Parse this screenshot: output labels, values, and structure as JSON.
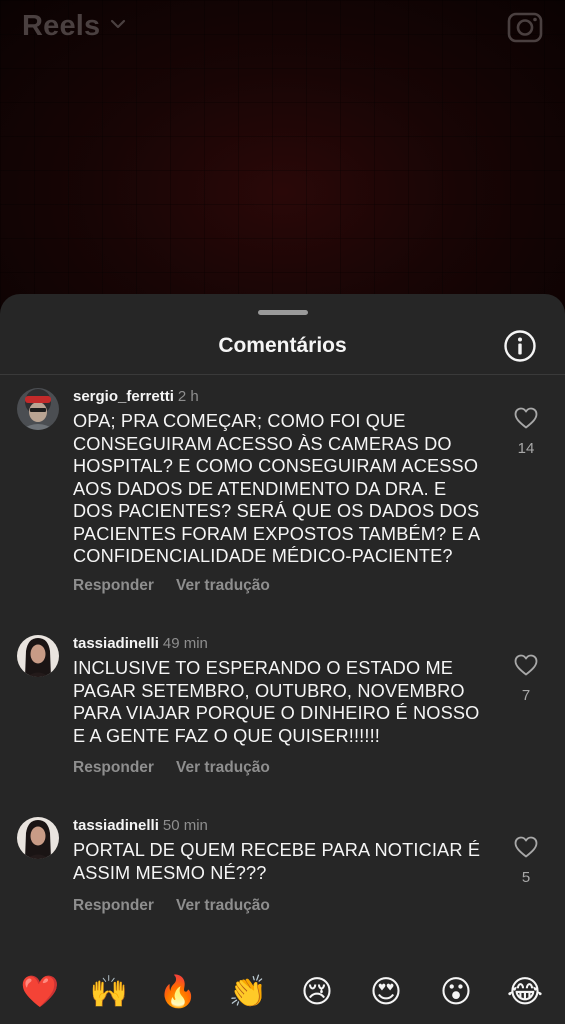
{
  "header": {
    "title": "Reels"
  },
  "sheet": {
    "title": "Comentários"
  },
  "comments": [
    {
      "username": "sergio_ferretti",
      "time": "2 h",
      "text": "OPA; PRA COMEÇAR; COMO FOI QUE\nCONSEGUIRAM ACESSO ÀS CAMERAS DO\nHOSPITAL? E COMO CONSEGUIRAM ACESSO\nAOS DADOS DE ATENDIMENTO DA DRA. E\nDOS PACIENTES? SERÁ QUE OS DADOS DOS\nPACIENTES FORAM EXPOSTOS TAMBÉM? E A\nCONFIDENCIALIDADE MÉDICO-PACIENTE?",
      "reply": "Responder",
      "translate": "Ver tradução",
      "likes": "14"
    },
    {
      "username": "tassiadinelli",
      "time": "49 min",
      "text": "INCLUSIVE TO ESPERANDO O ESTADO ME\nPAGAR SETEMBRO, OUTUBRO, NOVEMBRO\nPARA VIAJAR PORQUE O DINHEIRO É NOSSO\nE A GENTE FAZ O QUE QUISER!!!!!!",
      "reply": "Responder",
      "translate": "Ver tradução",
      "likes": "7"
    },
    {
      "username": "tassiadinelli",
      "time": "50 min",
      "text": "PORTAL DE QUEM RECEBE PARA NOTICIAR É\nASSIM MESMO NÉ???",
      "reply": "Responder",
      "translate": "Ver tradução",
      "likes": "5"
    }
  ],
  "emoji_bar": [
    "❤️",
    "🙌",
    "🔥",
    "👏",
    "😢",
    "😍",
    "😮",
    "😂"
  ]
}
